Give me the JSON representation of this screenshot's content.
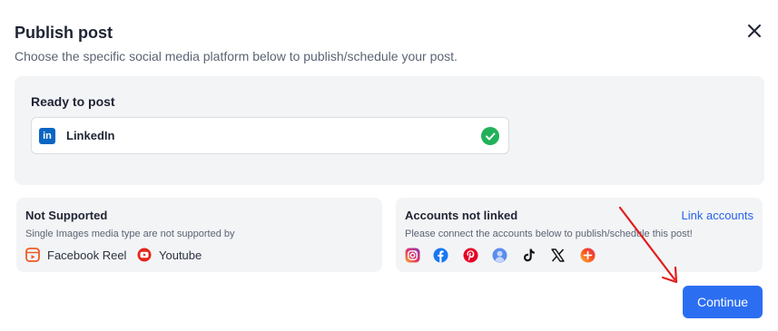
{
  "dialog": {
    "title": "Publish post",
    "subtitle": "Choose the specific social media platform below to publish/schedule your post.",
    "close_icon": "close-icon"
  },
  "ready": {
    "heading": "Ready to post",
    "platform": "LinkedIn",
    "badge_text": "in",
    "status_icon": "check-circle-icon",
    "status_color": "#22b15a"
  },
  "not_supported": {
    "heading": "Not Supported",
    "description": "Single Images media type are not supported by",
    "items": [
      {
        "label": "Facebook Reel",
        "icon": "facebook-reel-icon"
      },
      {
        "label": "Youtube",
        "icon": "youtube-icon"
      }
    ]
  },
  "not_linked": {
    "heading": "Accounts not linked",
    "link_label": "Link accounts",
    "description": "Please connect the accounts below to publish/schedule this post!",
    "icons": [
      "instagram-icon",
      "facebook-icon",
      "pinterest-icon",
      "bluesky-icon",
      "tiktok-icon",
      "x-icon",
      "threads-icon"
    ]
  },
  "footer": {
    "continue_label": "Continue",
    "accent_color": "#2b6ef2"
  },
  "annotation": {
    "arrow_color": "#e11d1d"
  }
}
